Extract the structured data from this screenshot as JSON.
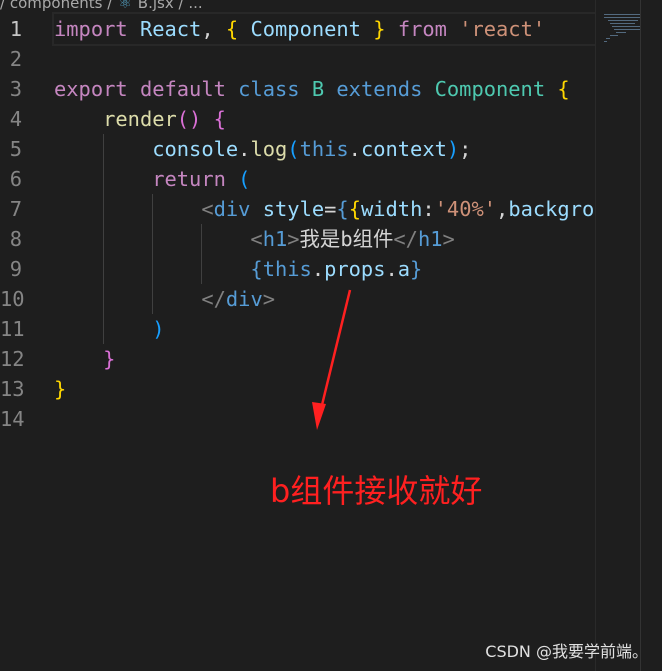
{
  "breadcrumb": {
    "folder": "components",
    "file_icon": "react-icon",
    "file": "B.jsx",
    "more": "..."
  },
  "code_lines": [
    {
      "n": "1",
      "cur": true,
      "indent": 0,
      "tokens": [
        [
          "import",
          "kw"
        ],
        [
          " ",
          "pn"
        ],
        [
          "React",
          "id"
        ],
        [
          ", ",
          "pn"
        ],
        [
          "{",
          "br"
        ],
        [
          " ",
          "pn"
        ],
        [
          "Component",
          "id"
        ],
        [
          " ",
          "pn"
        ],
        [
          "}",
          "br"
        ],
        [
          " ",
          "pn"
        ],
        [
          "from",
          "kw"
        ],
        [
          " ",
          "pn"
        ],
        [
          "'react'",
          "str"
        ]
      ]
    },
    {
      "n": "2",
      "indent": 0,
      "tokens": []
    },
    {
      "n": "3",
      "indent": 0,
      "tokens": [
        [
          "export",
          "kw"
        ],
        [
          " ",
          "pn"
        ],
        [
          "default",
          "kw"
        ],
        [
          " ",
          "pn"
        ],
        [
          "class",
          "st"
        ],
        [
          " ",
          "pn"
        ],
        [
          "B",
          "ty"
        ],
        [
          " ",
          "pn"
        ],
        [
          "extends",
          "st"
        ],
        [
          " ",
          "pn"
        ],
        [
          "Component",
          "ty"
        ],
        [
          " ",
          "pn"
        ],
        [
          "{",
          "br"
        ]
      ]
    },
    {
      "n": "4",
      "indent": 1,
      "tokens": [
        [
          "render",
          "fn"
        ],
        [
          "()",
          "br2"
        ],
        [
          " ",
          "pn"
        ],
        [
          "{",
          "br2"
        ]
      ]
    },
    {
      "n": "5",
      "indent": 2,
      "tokens": [
        [
          "console",
          "id"
        ],
        [
          ".",
          "pn"
        ],
        [
          "log",
          "fn"
        ],
        [
          "(",
          "br3"
        ],
        [
          "this",
          "st"
        ],
        [
          ".",
          "pn"
        ],
        [
          "context",
          "id"
        ],
        [
          ")",
          "br3"
        ],
        [
          ";",
          "pn"
        ]
      ]
    },
    {
      "n": "6",
      "indent": 2,
      "tokens": [
        [
          "return",
          "kw"
        ],
        [
          " ",
          "pn"
        ],
        [
          "(",
          "br3"
        ]
      ]
    },
    {
      "n": "7",
      "indent": 3,
      "tokens": [
        [
          "<",
          "ang"
        ],
        [
          "div",
          "tag"
        ],
        [
          " ",
          "pn"
        ],
        [
          "style",
          "id"
        ],
        [
          "=",
          "pn"
        ],
        [
          "{",
          "st"
        ],
        [
          "{",
          "br"
        ],
        [
          "width",
          "id"
        ],
        [
          ":",
          "pn"
        ],
        [
          "'40%'",
          "str"
        ],
        [
          ",",
          "pn"
        ],
        [
          "backgro",
          "id"
        ]
      ]
    },
    {
      "n": "8",
      "indent": 4,
      "tokens": [
        [
          "<",
          "ang"
        ],
        [
          "h1",
          "tag"
        ],
        [
          ">",
          "ang"
        ],
        [
          "我是b组件",
          "pn"
        ],
        [
          "</",
          "ang"
        ],
        [
          "h1",
          "tag"
        ],
        [
          ">",
          "ang"
        ]
      ]
    },
    {
      "n": "9",
      "indent": 4,
      "tokens": [
        [
          "{",
          "st"
        ],
        [
          "this",
          "st"
        ],
        [
          ".",
          "pn"
        ],
        [
          "props",
          "id"
        ],
        [
          ".",
          "pn"
        ],
        [
          "a",
          "id"
        ],
        [
          "}",
          "st"
        ]
      ]
    },
    {
      "n": "10",
      "indent": 3,
      "tokens": [
        [
          "</",
          "ang"
        ],
        [
          "div",
          "tag"
        ],
        [
          ">",
          "ang"
        ]
      ]
    },
    {
      "n": "11",
      "indent": 2,
      "tokens": [
        [
          ")",
          "br3"
        ]
      ]
    },
    {
      "n": "12",
      "indent": 1,
      "tokens": [
        [
          "}",
          "br2"
        ]
      ]
    },
    {
      "n": "13",
      "indent": 0,
      "tokens": [
        [
          "}",
          "br"
        ]
      ]
    },
    {
      "n": "14",
      "indent": 0,
      "tokens": []
    }
  ],
  "annotation": {
    "text": "b组件接收就好",
    "color": "#ff2020"
  },
  "watermark": "CSDN @我要学前端。"
}
